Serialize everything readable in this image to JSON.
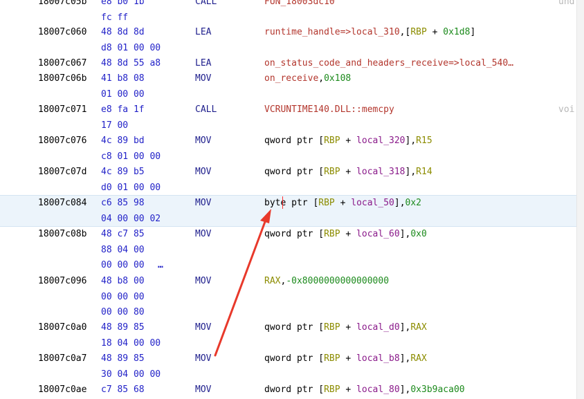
{
  "rows": [
    {
      "address": "18007c05b",
      "bytes": [
        "e8 b0 1b",
        "fc ff"
      ],
      "mnemonic": "CALL",
      "operands": [
        {
          "t": "FUN_18003dc10",
          "c": "fn"
        }
      ],
      "comment": "und"
    },
    {
      "address": "18007c060",
      "bytes": [
        "48 8d 8d",
        "d8 01 00 00"
      ],
      "mnemonic": "LEA",
      "operands": [
        {
          "t": "runtime_handle=>local_310",
          "c": "fn"
        },
        {
          "t": ",[",
          "c": "txt"
        },
        {
          "t": "RBP",
          "c": "reg"
        },
        {
          "t": " + ",
          "c": "txt"
        },
        {
          "t": "0x1d8",
          "c": "num"
        },
        {
          "t": "]",
          "c": "txt"
        }
      ]
    },
    {
      "address": "18007c067",
      "bytes": [
        "48 8d 55 a8"
      ],
      "mnemonic": "LEA",
      "operands": [
        {
          "t": "on_status_code_and_headers_receive=>local_540…",
          "c": "fn"
        }
      ]
    },
    {
      "address": "18007c06b",
      "bytes": [
        "41 b8 08",
        "01 00 00"
      ],
      "mnemonic": "MOV",
      "operands": [
        {
          "t": "on_receive",
          "c": "fn"
        },
        {
          "t": ",",
          "c": "txt"
        },
        {
          "t": "0x108",
          "c": "num"
        }
      ]
    },
    {
      "address": "18007c071",
      "bytes": [
        "e8 fa 1f",
        "17 00"
      ],
      "mnemonic": "CALL",
      "operands": [
        {
          "t": "VCRUNTIME140.DLL::memcpy",
          "c": "fn"
        }
      ],
      "comment": "voi"
    },
    {
      "address": "18007c076",
      "bytes": [
        "4c 89 bd",
        "c8 01 00 00"
      ],
      "mnemonic": "MOV",
      "operands": [
        {
          "t": "qword ptr [",
          "c": "txt"
        },
        {
          "t": "RBP",
          "c": "reg"
        },
        {
          "t": " + ",
          "c": "txt"
        },
        {
          "t": "local_320",
          "c": "lbl"
        },
        {
          "t": "],",
          "c": "txt"
        },
        {
          "t": "R15",
          "c": "reg"
        }
      ]
    },
    {
      "address": "18007c07d",
      "bytes": [
        "4c 89 b5",
        "d0 01 00 00"
      ],
      "mnemonic": "MOV",
      "operands": [
        {
          "t": "qword ptr [",
          "c": "txt"
        },
        {
          "t": "RBP",
          "c": "reg"
        },
        {
          "t": " + ",
          "c": "txt"
        },
        {
          "t": "local_318",
          "c": "lbl"
        },
        {
          "t": "],",
          "c": "txt"
        },
        {
          "t": "R14",
          "c": "reg"
        }
      ]
    },
    {
      "address": "18007c084",
      "bytes": [
        "c6 85 98",
        "04 00 00 02"
      ],
      "mnemonic": "MOV",
      "highlighted": true,
      "operands": [
        {
          "t": "byte ptr [",
          "c": "txt"
        },
        {
          "t": "RBP",
          "c": "reg"
        },
        {
          "t": " + ",
          "c": "txt"
        },
        {
          "t": "local_50",
          "c": "lbl"
        },
        {
          "t": "],",
          "c": "txt"
        },
        {
          "t": "0x2",
          "c": "num"
        }
      ]
    },
    {
      "address": "18007c08b",
      "bytes": [
        "48 c7 85",
        "88 04 00",
        "00 00 00"
      ],
      "ellipsis": "…",
      "mnemonic": "MOV",
      "operands": [
        {
          "t": "qword ptr [",
          "c": "txt"
        },
        {
          "t": "RBP",
          "c": "reg"
        },
        {
          "t": " + ",
          "c": "txt"
        },
        {
          "t": "local_60",
          "c": "lbl"
        },
        {
          "t": "],",
          "c": "txt"
        },
        {
          "t": "0x0",
          "c": "num"
        }
      ]
    },
    {
      "address": "18007c096",
      "bytes": [
        "48 b8 00",
        "00 00 00",
        "00 00 80"
      ],
      "mnemonic": "MOV",
      "operands": [
        {
          "t": "RAX",
          "c": "reg"
        },
        {
          "t": ",",
          "c": "txt"
        },
        {
          "t": "-0x8000000000000000",
          "c": "num"
        }
      ]
    },
    {
      "address": "18007c0a0",
      "bytes": [
        "48 89 85",
        "18 04 00 00"
      ],
      "mnemonic": "MOV",
      "operands": [
        {
          "t": "qword ptr [",
          "c": "txt"
        },
        {
          "t": "RBP",
          "c": "reg"
        },
        {
          "t": " + ",
          "c": "txt"
        },
        {
          "t": "local_d0",
          "c": "lbl"
        },
        {
          "t": "],",
          "c": "txt"
        },
        {
          "t": "RAX",
          "c": "reg"
        }
      ]
    },
    {
      "address": "18007c0a7",
      "bytes": [
        "48 89 85",
        "30 04 00 00"
      ],
      "mnemonic": "MOV",
      "operands": [
        {
          "t": "qword ptr [",
          "c": "txt"
        },
        {
          "t": "RBP",
          "c": "reg"
        },
        {
          "t": " + ",
          "c": "txt"
        },
        {
          "t": "local_b8",
          "c": "lbl"
        },
        {
          "t": "],",
          "c": "txt"
        },
        {
          "t": "RAX",
          "c": "reg"
        }
      ]
    },
    {
      "address": "18007c0ae",
      "bytes": [
        "c7 85 68"
      ],
      "mnemonic": "MOV",
      "operands": [
        {
          "t": "dword ptr [",
          "c": "txt"
        },
        {
          "t": "RBP",
          "c": "reg"
        },
        {
          "t": " + ",
          "c": "txt"
        },
        {
          "t": "local_80",
          "c": "lbl"
        },
        {
          "t": "],",
          "c": "txt"
        },
        {
          "t": "0x3b9aca00",
          "c": "num"
        }
      ]
    }
  ],
  "colors": {
    "highlight_row": "#ecf4fb",
    "arrow": "#e8392b",
    "cursor": "#ff3030"
  }
}
